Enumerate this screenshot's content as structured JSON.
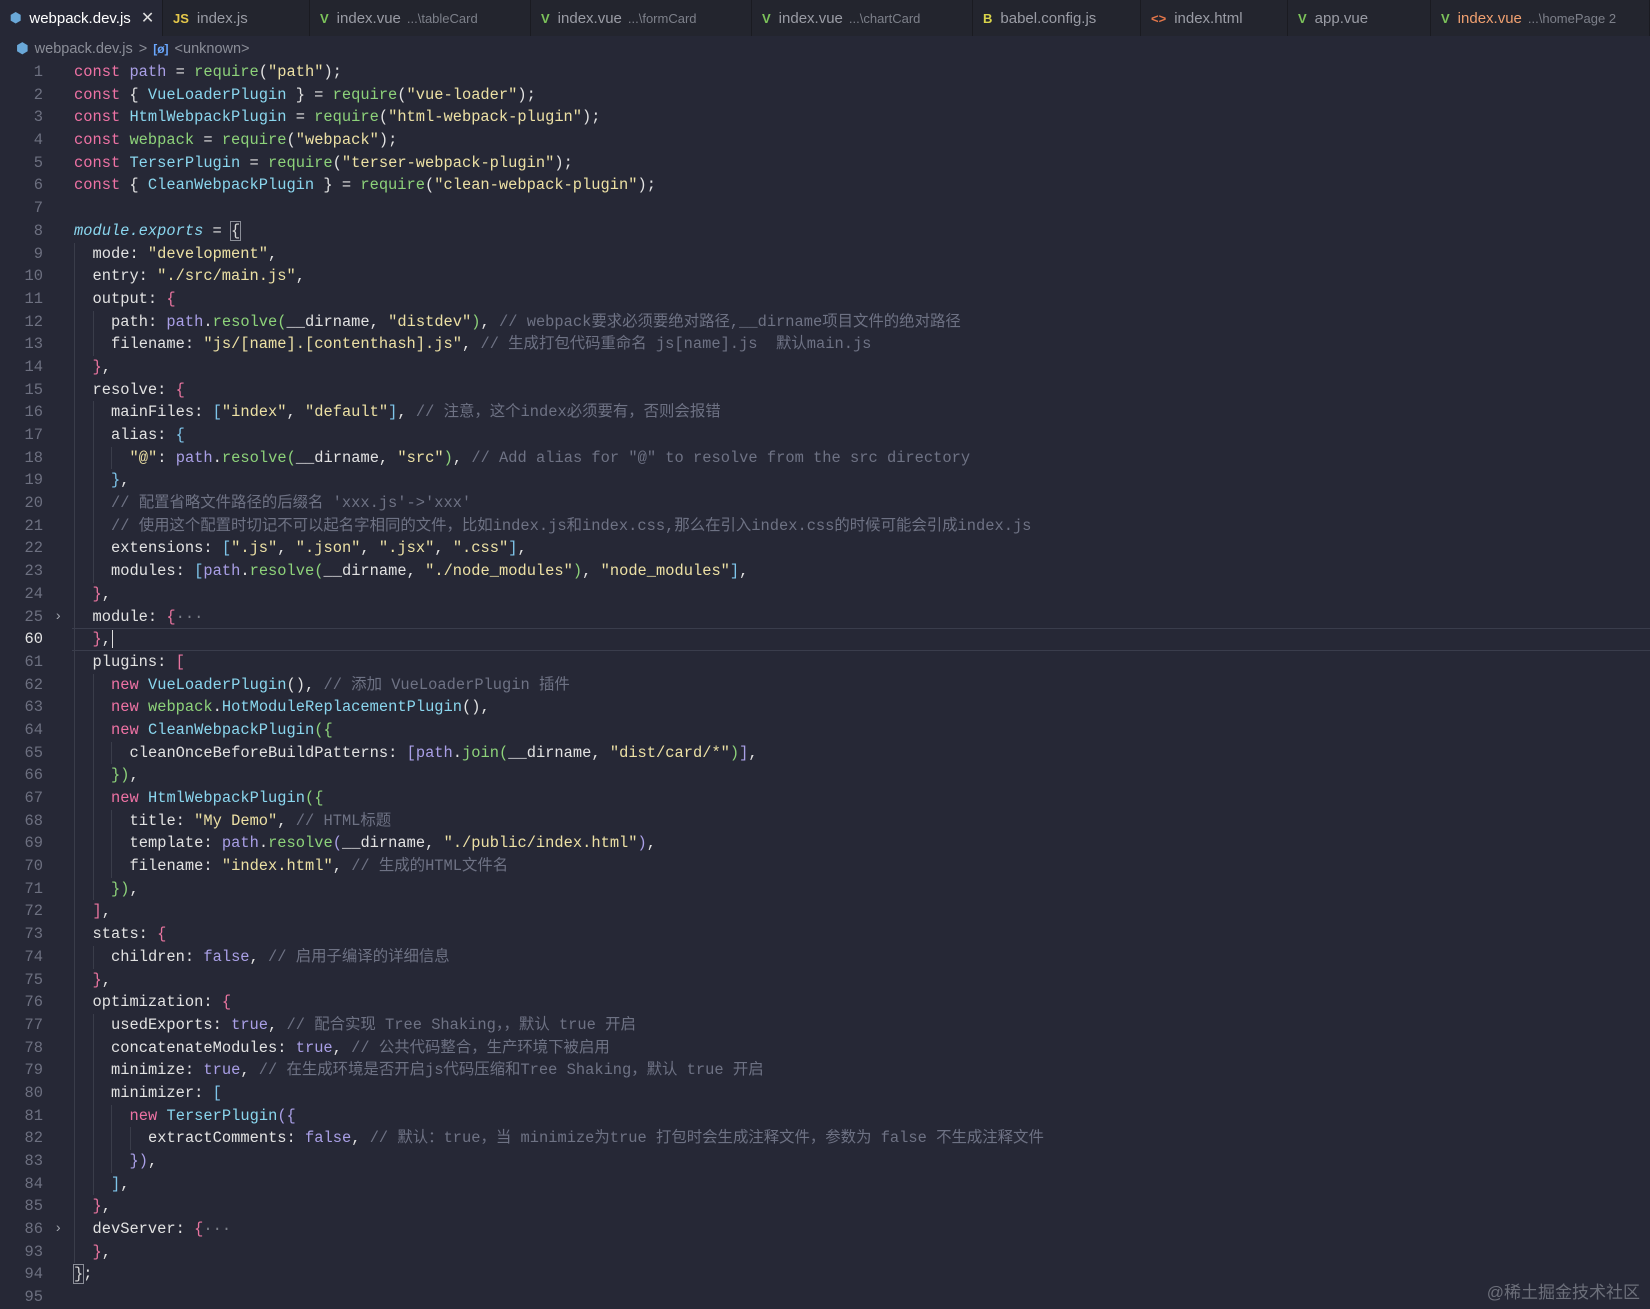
{
  "tabs": [
    {
      "name": "webpack.dev.js",
      "icon": "webpack-icon",
      "glyph": "⬢",
      "color": "#6aa8d8",
      "active": true
    },
    {
      "name": "index.js",
      "icon": "js-icon",
      "glyph": "JS",
      "color": "#e5c84a"
    },
    {
      "name": "index.vue",
      "desc": "...\\tableCard",
      "icon": "vue-icon",
      "glyph": "V",
      "color": "#7cc35a"
    },
    {
      "name": "index.vue",
      "desc": "...\\formCard",
      "icon": "vue-icon",
      "glyph": "V",
      "color": "#7cc35a"
    },
    {
      "name": "index.vue",
      "desc": "...\\chartCard",
      "icon": "vue-icon",
      "glyph": "V",
      "color": "#7cc35a"
    },
    {
      "name": "babel.config.js",
      "icon": "babel-icon",
      "glyph": "B",
      "color": "#d9d44a"
    },
    {
      "name": "index.html",
      "icon": "html-icon",
      "glyph": "<>",
      "color": "#e3764a"
    },
    {
      "name": "app.vue",
      "icon": "vue-icon",
      "glyph": "V",
      "color": "#7cc35a"
    },
    {
      "name": "index.vue",
      "desc": "...\\homePage 2",
      "icon": "vue-icon",
      "glyph": "V",
      "color": "#7cc35a",
      "modified": true
    }
  ],
  "breadcrumb": {
    "file": "webpack.dev.js",
    "separator": ">",
    "symbol": "[ø]",
    "scope": "<unknown>"
  },
  "lines": [
    {
      "n": "1",
      "i": 0,
      "t": [
        [
          "k",
          "const"
        ],
        [
          "p",
          " "
        ],
        [
          "v",
          "path"
        ],
        [
          "p",
          " = "
        ],
        [
          "f",
          "require"
        ],
        [
          "p",
          "("
        ],
        [
          "s",
          "\"path\""
        ],
        [
          "p",
          ");"
        ]
      ]
    },
    {
      "n": "2",
      "i": 0,
      "t": [
        [
          "k",
          "const"
        ],
        [
          "p",
          " { "
        ],
        [
          "c",
          "VueLoaderPlugin"
        ],
        [
          "p",
          " } = "
        ],
        [
          "f",
          "require"
        ],
        [
          "p",
          "("
        ],
        [
          "s",
          "\"vue-loader\""
        ],
        [
          "p",
          ");"
        ]
      ]
    },
    {
      "n": "3",
      "i": 0,
      "t": [
        [
          "k",
          "const"
        ],
        [
          "p",
          " "
        ],
        [
          "c",
          "HtmlWebpackPlugin"
        ],
        [
          "p",
          " = "
        ],
        [
          "f",
          "require"
        ],
        [
          "p",
          "("
        ],
        [
          "s",
          "\"html-webpack-plugin\""
        ],
        [
          "p",
          ");"
        ]
      ]
    },
    {
      "n": "4",
      "i": 0,
      "t": [
        [
          "k",
          "const"
        ],
        [
          "p",
          " "
        ],
        [
          "gr",
          "webpack"
        ],
        [
          "p",
          " = "
        ],
        [
          "f",
          "require"
        ],
        [
          "p",
          "("
        ],
        [
          "s",
          "\"webpack\""
        ],
        [
          "p",
          ");"
        ]
      ]
    },
    {
      "n": "5",
      "i": 0,
      "t": [
        [
          "k",
          "const"
        ],
        [
          "p",
          " "
        ],
        [
          "c",
          "TerserPlugin"
        ],
        [
          "p",
          " = "
        ],
        [
          "f",
          "require"
        ],
        [
          "p",
          "("
        ],
        [
          "s",
          "\"terser-webpack-plugin\""
        ],
        [
          "p",
          ");"
        ]
      ]
    },
    {
      "n": "6",
      "i": 0,
      "t": [
        [
          "k",
          "const"
        ],
        [
          "p",
          " { "
        ],
        [
          "c",
          "CleanWebpackPlugin"
        ],
        [
          "p",
          " } = "
        ],
        [
          "f",
          "require"
        ],
        [
          "p",
          "("
        ],
        [
          "s",
          "\"clean-webpack-plugin\""
        ],
        [
          "p",
          ");"
        ]
      ]
    },
    {
      "n": "7",
      "i": 0,
      "t": []
    },
    {
      "n": "8",
      "i": 0,
      "t": [
        [
          "it",
          "module.exports"
        ],
        [
          "p",
          " = "
        ],
        [
          "bx",
          "{"
        ]
      ]
    },
    {
      "n": "9",
      "i": 1,
      "t": [
        [
          "p",
          "mode: "
        ],
        [
          "s",
          "\"development\""
        ],
        [
          "p",
          ","
        ]
      ]
    },
    {
      "n": "10",
      "i": 1,
      "t": [
        [
          "p",
          "entry: "
        ],
        [
          "s",
          "\"./src/main.js\""
        ],
        [
          "p",
          ","
        ]
      ]
    },
    {
      "n": "11",
      "i": 1,
      "t": [
        [
          "p",
          "output: "
        ],
        [
          "pk",
          "{"
        ]
      ]
    },
    {
      "n": "12",
      "i": 2,
      "t": [
        [
          "p",
          "path: "
        ],
        [
          "v",
          "path"
        ],
        [
          "p",
          "."
        ],
        [
          "f",
          "resolve"
        ],
        [
          "gr",
          "("
        ],
        [
          "p",
          "__dirname, "
        ],
        [
          "s",
          "\"distdev\""
        ],
        [
          "gr",
          ")"
        ],
        [
          "p",
          ", "
        ],
        [
          "cm",
          "// webpack要求必须要绝对路径,__dirname项目文件的绝对路径"
        ]
      ]
    },
    {
      "n": "13",
      "i": 2,
      "t": [
        [
          "p",
          "filename: "
        ],
        [
          "s",
          "\"js/[name].[contenthash].js\""
        ],
        [
          "p",
          ", "
        ],
        [
          "cm",
          "// 生成打包代码重命名 js[name].js  默认main.js"
        ]
      ]
    },
    {
      "n": "14",
      "i": 1,
      "t": [
        [
          "pk",
          "}"
        ],
        [
          "p",
          ","
        ]
      ]
    },
    {
      "n": "15",
      "i": 1,
      "t": [
        [
          "p",
          "resolve: "
        ],
        [
          "pk",
          "{"
        ]
      ]
    },
    {
      "n": "16",
      "i": 2,
      "t": [
        [
          "p",
          "mainFiles: "
        ],
        [
          "bl",
          "["
        ],
        [
          "s",
          "\"index\""
        ],
        [
          "p",
          ", "
        ],
        [
          "s",
          "\"default\""
        ],
        [
          "bl",
          "]"
        ],
        [
          "p",
          ", "
        ],
        [
          "cm",
          "// 注意，这个index必须要有，否则会报错"
        ]
      ]
    },
    {
      "n": "17",
      "i": 2,
      "t": [
        [
          "p",
          "alias: "
        ],
        [
          "bl",
          "{"
        ]
      ]
    },
    {
      "n": "18",
      "i": 3,
      "t": [
        [
          "s",
          "\"@\""
        ],
        [
          "p",
          ": "
        ],
        [
          "v",
          "path"
        ],
        [
          "p",
          "."
        ],
        [
          "f",
          "resolve"
        ],
        [
          "gr",
          "("
        ],
        [
          "p",
          "__dirname, "
        ],
        [
          "s",
          "\"src\""
        ],
        [
          "gr",
          ")"
        ],
        [
          "p",
          ", "
        ],
        [
          "cm",
          "// Add alias for \"@\" to resolve from the src directory"
        ]
      ]
    },
    {
      "n": "19",
      "i": 2,
      "t": [
        [
          "bl",
          "}"
        ],
        [
          "p",
          ","
        ]
      ]
    },
    {
      "n": "20",
      "i": 2,
      "t": [
        [
          "cm",
          "// 配置省略文件路径的后缀名 'xxx.js'->'xxx'"
        ]
      ]
    },
    {
      "n": "21",
      "i": 2,
      "t": [
        [
          "cm",
          "// 使用这个配置时切记不可以起名字相同的文件，比如index.js和index.css,那么在引入index.css的时候可能会引成index.js"
        ]
      ]
    },
    {
      "n": "22",
      "i": 2,
      "t": [
        [
          "p",
          "extensions: "
        ],
        [
          "bl",
          "["
        ],
        [
          "s",
          "\".js\""
        ],
        [
          "p",
          ", "
        ],
        [
          "s",
          "\".json\""
        ],
        [
          "p",
          ", "
        ],
        [
          "s",
          "\".jsx\""
        ],
        [
          "p",
          ", "
        ],
        [
          "s",
          "\".css\""
        ],
        [
          "bl",
          "]"
        ],
        [
          "p",
          ","
        ]
      ]
    },
    {
      "n": "23",
      "i": 2,
      "t": [
        [
          "p",
          "modules: "
        ],
        [
          "bl",
          "["
        ],
        [
          "v",
          "path"
        ],
        [
          "p",
          "."
        ],
        [
          "f",
          "resolve"
        ],
        [
          "gr",
          "("
        ],
        [
          "p",
          "__dirname, "
        ],
        [
          "s",
          "\"./node_modules\""
        ],
        [
          "gr",
          ")"
        ],
        [
          "p",
          ", "
        ],
        [
          "s",
          "\"node_modules\""
        ],
        [
          "bl",
          "]"
        ],
        [
          "p",
          ","
        ]
      ]
    },
    {
      "n": "24",
      "i": 1,
      "t": [
        [
          "pk",
          "}"
        ],
        [
          "p",
          ","
        ]
      ]
    },
    {
      "n": "25",
      "i": 1,
      "fold": true,
      "t": [
        [
          "p",
          "module: "
        ],
        [
          "pk",
          "{"
        ],
        [
          "el",
          "···"
        ]
      ]
    },
    {
      "n": "60",
      "i": 1,
      "current": true,
      "t": [
        [
          "pk",
          "}"
        ],
        [
          "p",
          ","
        ]
      ]
    },
    {
      "n": "61",
      "i": 1,
      "t": [
        [
          "p",
          "plugins: "
        ],
        [
          "pk",
          "["
        ]
      ]
    },
    {
      "n": "62",
      "i": 2,
      "t": [
        [
          "k",
          "new"
        ],
        [
          "p",
          " "
        ],
        [
          "c",
          "VueLoaderPlugin"
        ],
        [
          "p",
          "(), "
        ],
        [
          "cm",
          "// 添加 VueLoaderPlugin 插件"
        ]
      ]
    },
    {
      "n": "63",
      "i": 2,
      "t": [
        [
          "k",
          "new"
        ],
        [
          "p",
          " "
        ],
        [
          "gr",
          "webpack"
        ],
        [
          "p",
          "."
        ],
        [
          "c",
          "HotModuleReplacementPlugin"
        ],
        [
          "p",
          "(),"
        ]
      ]
    },
    {
      "n": "64",
      "i": 2,
      "t": [
        [
          "k",
          "new"
        ],
        [
          "p",
          " "
        ],
        [
          "c",
          "CleanWebpackPlugin"
        ],
        [
          "gr",
          "({"
        ]
      ]
    },
    {
      "n": "65",
      "i": 3,
      "t": [
        [
          "p",
          "cleanOnceBeforeBuildPatterns: "
        ],
        [
          "pu",
          "["
        ],
        [
          "v",
          "path"
        ],
        [
          "p",
          "."
        ],
        [
          "f",
          "join"
        ],
        [
          "gr",
          "("
        ],
        [
          "p",
          "__dirname, "
        ],
        [
          "s",
          "\"dist/card/*\""
        ],
        [
          "gr",
          ")"
        ],
        [
          "pu",
          "]"
        ],
        [
          "p",
          ","
        ]
      ]
    },
    {
      "n": "66",
      "i": 2,
      "t": [
        [
          "gr",
          "})"
        ],
        [
          "p",
          ","
        ]
      ]
    },
    {
      "n": "67",
      "i": 2,
      "t": [
        [
          "k",
          "new"
        ],
        [
          "p",
          " "
        ],
        [
          "c",
          "HtmlWebpackPlugin"
        ],
        [
          "gr",
          "({"
        ]
      ]
    },
    {
      "n": "68",
      "i": 3,
      "t": [
        [
          "p",
          "title: "
        ],
        [
          "s",
          "\"My Demo\""
        ],
        [
          "p",
          ", "
        ],
        [
          "cm",
          "// HTML标题"
        ]
      ]
    },
    {
      "n": "69",
      "i": 3,
      "t": [
        [
          "p",
          "template: "
        ],
        [
          "v",
          "path"
        ],
        [
          "p",
          "."
        ],
        [
          "f",
          "resolve"
        ],
        [
          "pu",
          "("
        ],
        [
          "p",
          "__dirname, "
        ],
        [
          "s",
          "\"./public/index.html\""
        ],
        [
          "pu",
          ")"
        ],
        [
          "p",
          ","
        ]
      ]
    },
    {
      "n": "70",
      "i": 3,
      "t": [
        [
          "p",
          "filename: "
        ],
        [
          "s",
          "\"index.html\""
        ],
        [
          "p",
          ", "
        ],
        [
          "cm",
          "// 生成的HTML文件名"
        ]
      ]
    },
    {
      "n": "71",
      "i": 2,
      "t": [
        [
          "gr",
          "})"
        ],
        [
          "p",
          ","
        ]
      ]
    },
    {
      "n": "72",
      "i": 1,
      "t": [
        [
          "pk",
          "]"
        ],
        [
          "p",
          ","
        ]
      ]
    },
    {
      "n": "73",
      "i": 1,
      "t": [
        [
          "p",
          "stats: "
        ],
        [
          "pk",
          "{"
        ]
      ]
    },
    {
      "n": "74",
      "i": 2,
      "t": [
        [
          "p",
          "children: "
        ],
        [
          "b",
          "false"
        ],
        [
          "p",
          ", "
        ],
        [
          "cm",
          "// 启用子编译的详细信息"
        ]
      ]
    },
    {
      "n": "75",
      "i": 1,
      "t": [
        [
          "pk",
          "}"
        ],
        [
          "p",
          ","
        ]
      ]
    },
    {
      "n": "76",
      "i": 1,
      "t": [
        [
          "p",
          "optimization: "
        ],
        [
          "pk",
          "{"
        ]
      ]
    },
    {
      "n": "77",
      "i": 2,
      "t": [
        [
          "p",
          "usedExports: "
        ],
        [
          "b",
          "true"
        ],
        [
          "p",
          ", "
        ],
        [
          "cm",
          "// 配合实现 Tree Shaking，，默认 true 开启"
        ]
      ]
    },
    {
      "n": "78",
      "i": 2,
      "t": [
        [
          "p",
          "concatenateModules: "
        ],
        [
          "b",
          "true"
        ],
        [
          "p",
          ", "
        ],
        [
          "cm",
          "// 公共代码整合，生产环境下被启用"
        ]
      ]
    },
    {
      "n": "79",
      "i": 2,
      "t": [
        [
          "p",
          "minimize: "
        ],
        [
          "b",
          "true"
        ],
        [
          "p",
          ", "
        ],
        [
          "cm",
          "// 在生成环境是否开启js代码压缩和Tree Shaking，默认 true 开启"
        ]
      ]
    },
    {
      "n": "80",
      "i": 2,
      "t": [
        [
          "p",
          "minimizer: "
        ],
        [
          "bl",
          "["
        ]
      ]
    },
    {
      "n": "81",
      "i": 3,
      "t": [
        [
          "k",
          "new"
        ],
        [
          "p",
          " "
        ],
        [
          "c",
          "TerserPlugin"
        ],
        [
          "pu",
          "({"
        ]
      ]
    },
    {
      "n": "82",
      "i": 4,
      "t": [
        [
          "p",
          "extractComments: "
        ],
        [
          "b",
          "false"
        ],
        [
          "p",
          ", "
        ],
        [
          "cm",
          "// 默认：true，当 minimize为true 打包时会生成注释文件，参数为 false 不生成注释文件"
        ]
      ]
    },
    {
      "n": "83",
      "i": 3,
      "t": [
        [
          "pu",
          "})"
        ],
        [
          "p",
          ","
        ]
      ]
    },
    {
      "n": "84",
      "i": 2,
      "t": [
        [
          "bl",
          "]"
        ],
        [
          "p",
          ","
        ]
      ]
    },
    {
      "n": "85",
      "i": 1,
      "t": [
        [
          "pk",
          "}"
        ],
        [
          "p",
          ","
        ]
      ]
    },
    {
      "n": "86",
      "i": 1,
      "fold": true,
      "t": [
        [
          "p",
          "devServer: "
        ],
        [
          "pk",
          "{"
        ],
        [
          "el",
          "···"
        ]
      ]
    },
    {
      "n": "93",
      "i": 1,
      "t": [
        [
          "pk",
          "}"
        ],
        [
          "p",
          ","
        ]
      ]
    },
    {
      "n": "94",
      "i": 0,
      "t": [
        [
          "bx",
          "}"
        ],
        [
          "p",
          ";"
        ]
      ]
    },
    {
      "n": "95",
      "i": 0,
      "t": []
    }
  ],
  "watermark": "@稀土掘金技术社区"
}
